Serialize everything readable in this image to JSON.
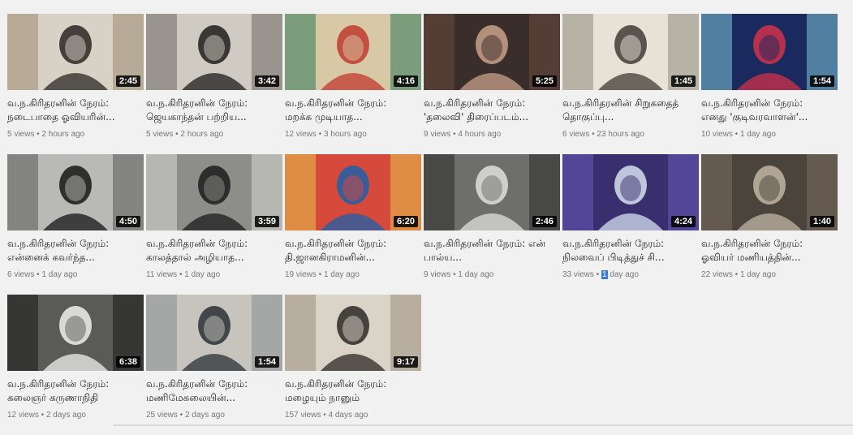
{
  "videos": [
    {
      "title": "வ.ந.கிரிதரனின் நேரம்: நடைபாதை ஓவியரின்...",
      "views": "5 views",
      "sep": " • ",
      "time": "2 hours ago",
      "duration": "2:45",
      "thumb": {
        "bg": "#d8d2c6",
        "fg": "#2a2622",
        "accent": "#9c8a72"
      }
    },
    {
      "title": "வ.ந.கிரிதரனின் நேரம்: ஜெயகாந்தன் பற்றிய...",
      "views": "5 views",
      "sep": " • ",
      "time": "2 hours ago",
      "duration": "3:42",
      "thumb": {
        "bg": "#cfcbc3",
        "fg": "#1e1c1a",
        "accent": "#6d6860"
      }
    },
    {
      "title": "வ.ந.கிரிதரனின் நேரம்: மறக்க முடியாத...",
      "views": "12 views",
      "sep": " • ",
      "time": "3 hours ago",
      "duration": "4:16",
      "thumb": {
        "bg": "#d7c8a6",
        "fg": "#c03a2f",
        "accent": "#2f7a5a"
      }
    },
    {
      "title": "வ.ந.கிரிதரனின் நேரம்: 'தலைவி' திரைப்படம்...",
      "views": "9 views",
      "sep": " • ",
      "time": "4 hours ago",
      "duration": "5:25",
      "thumb": {
        "bg": "#3a2e2a",
        "fg": "#caa08a",
        "accent": "#6a4b3e"
      }
    },
    {
      "title": "வ.ந.கிரிதரனின் சிறுகதைத் தொகுப்பு...",
      "views": "6 views",
      "sep": " • ",
      "time": "23 hours ago",
      "duration": "1:45",
      "thumb": {
        "bg": "#e6e2d6",
        "fg": "#403c36",
        "accent": "#8f8a80"
      }
    },
    {
      "title": "வ.ந.கிரிதரனின் நேரம்: எனது 'குடிவரவாளன்'...",
      "views": "10 views",
      "sep": " • ",
      "time": "1 day ago",
      "duration": "1:54",
      "thumb": {
        "bg": "#1b2a5e",
        "fg": "#d0324a",
        "accent": "#7dc4d8"
      }
    },
    {
      "title": "வ.ந.கிரிதரனின் நேரம்: என்னைக் கவர்ந்த...",
      "views": "6 views",
      "sep": " • ",
      "time": "1 day ago",
      "duration": "4:50",
      "thumb": {
        "bg": "#b9b9b6",
        "fg": "#161616",
        "accent": "#5a5a58"
      }
    },
    {
      "title": "வ.ந.கிரிதரனின் நேரம்: காலத்தால் அழியாத...",
      "views": "11 views",
      "sep": " • ",
      "time": "1 day ago",
      "duration": "3:59",
      "thumb": {
        "bg": "#8d8d8a",
        "fg": "#1c1c1c",
        "accent": "#d8d8d4"
      }
    },
    {
      "title": "வ.ந.கிரிதரனின் நேரம்: தி.ஜானகிராமனின்...",
      "views": "19 views",
      "sep": " • ",
      "time": "1 day ago",
      "duration": "6:20",
      "thumb": {
        "bg": "#d64a3c",
        "fg": "#1e5fa8",
        "accent": "#e8c24a"
      }
    },
    {
      "title": "வ.ந.கிரிதரனின் நேரம்: என் பால்ய...",
      "views": "9 views",
      "sep": " • ",
      "time": "1 day ago",
      "duration": "2:46",
      "thumb": {
        "bg": "#6e6e6c",
        "fg": "#e0e0dc",
        "accent": "#2a2a2a"
      }
    },
    {
      "title": "வ.ந.கிரிதரனின் நேரம்: நிலவைப் பிடித்துச் சி...",
      "views": "33 views",
      "sep": " • ",
      "time_hl": "1",
      "time": " day ago",
      "duration": "4:24",
      "thumb": {
        "bg": "#3a2f6e",
        "fg": "#d6e0f0",
        "accent": "#6a5ab8"
      }
    },
    {
      "title": "வ.ந.கிரிதரனின் நேரம்: ஓவியர் மணியத்தின்...",
      "views": "22 views",
      "sep": " • ",
      "time": "1 day ago",
      "duration": "1:40",
      "thumb": {
        "bg": "#4a443c",
        "fg": "#c2b6a4",
        "accent": "#7a6e5e"
      }
    },
    {
      "title": "வ.ந.கிரிதரனின் நேரம்: கலைஞர் கருணாநிதி",
      "views": "12 views",
      "sep": " • ",
      "time": "2 days ago",
      "duration": "6:38",
      "thumb": {
        "bg": "#5a5a58",
        "fg": "#f0f0ee",
        "accent": "#1a1a1a"
      }
    },
    {
      "title": "வ.ந.கிரிதரனின் நேரம்: மணிமேகலையின்...",
      "views": "25 views",
      "sep": " • ",
      "time": "2 days ago",
      "duration": "1:54",
      "thumb": {
        "bg": "#c6c4bc",
        "fg": "#2a3036",
        "accent": "#8a9096"
      }
    },
    {
      "title": "வ.ந.கிரிதரனின் நேரம்: மழையும் நானும்",
      "views": "157 views",
      "sep": " • ",
      "time": "4 days ago",
      "duration": "9:17",
      "thumb": {
        "bg": "#d9d3c8",
        "fg": "#2c2824",
        "accent": "#9a8f80"
      }
    }
  ]
}
